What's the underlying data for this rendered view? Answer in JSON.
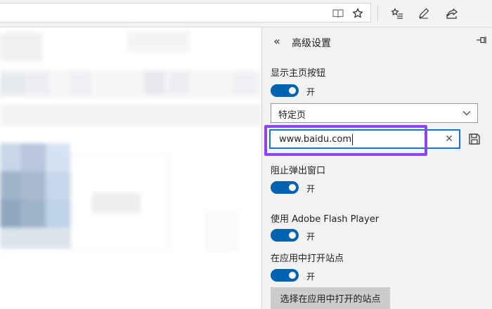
{
  "toolbar": {
    "icons": [
      "reading-view-icon",
      "favorite-star-icon",
      "favorites-hub-icon",
      "pen-notes-icon",
      "share-icon"
    ]
  },
  "panel": {
    "title": "高级设置",
    "show_home_button": {
      "label": "显示主页按钮",
      "state": "开",
      "dropdown_value": "特定页",
      "url_value": "www.baidu.com"
    },
    "block_popups": {
      "label": "阻止弹出窗口",
      "state": "开"
    },
    "flash_player": {
      "label": "使用 Adobe Flash Player",
      "state": "开"
    },
    "open_in_apps": {
      "label": "在应用中打开站点",
      "state": "开",
      "button_label": "选择在应用中打开的站点"
    }
  },
  "colors": {
    "accent": "#0063b1",
    "highlight": "#8e44ec",
    "input_border": "#1b73c9"
  }
}
